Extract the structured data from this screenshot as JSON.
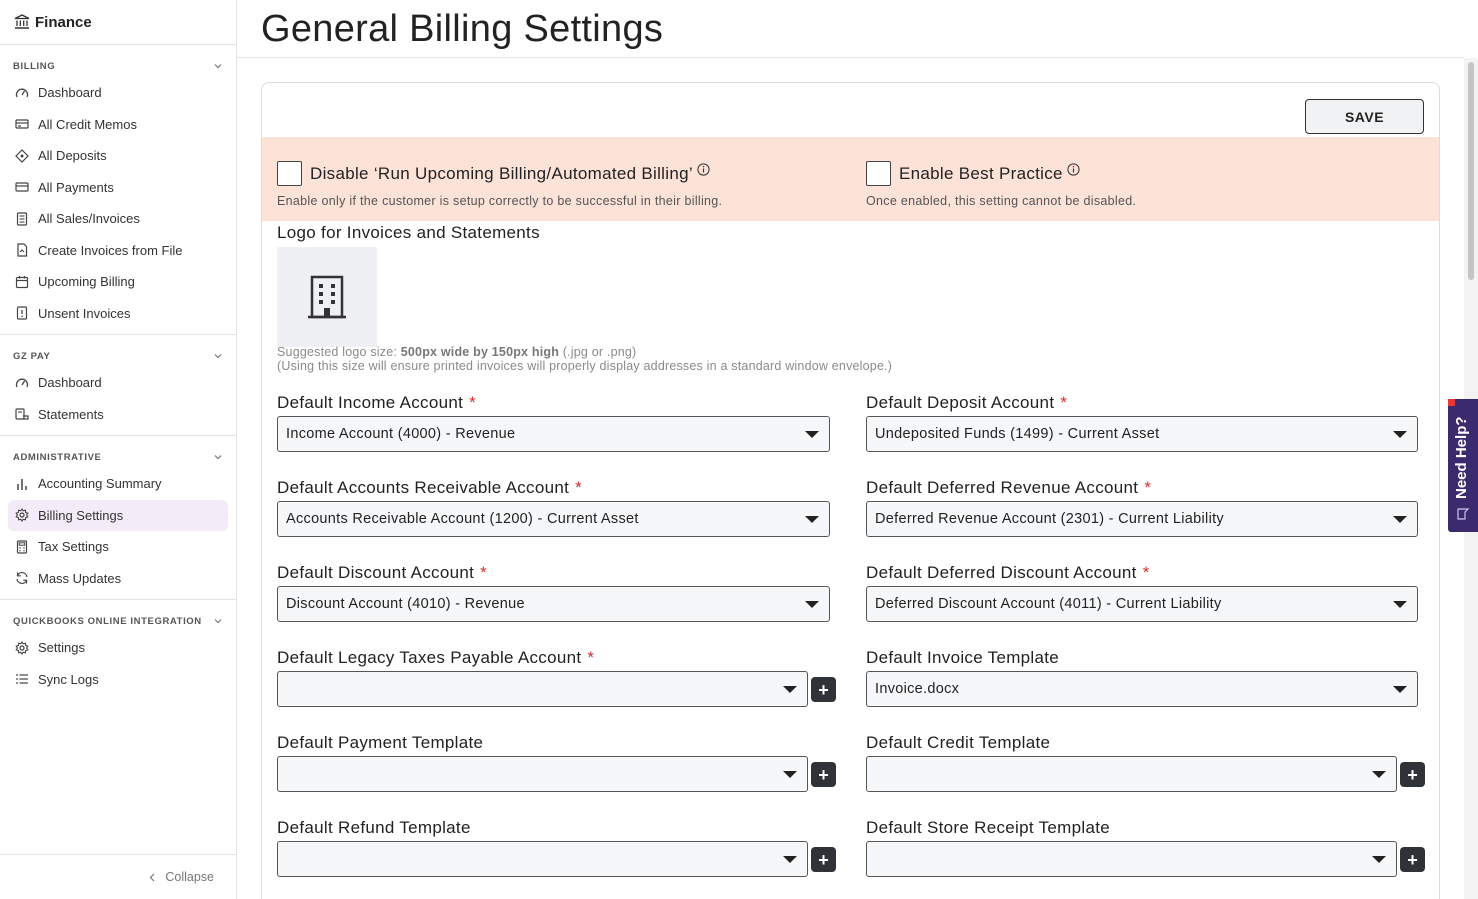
{
  "sidebar": {
    "brand": "Finance",
    "sections": [
      {
        "title": "BILLING",
        "items": [
          {
            "label": "Dashboard",
            "icon": "dashboard-icon"
          },
          {
            "label": "All Credit Memos",
            "icon": "credit-memo-icon"
          },
          {
            "label": "All Deposits",
            "icon": "deposit-icon"
          },
          {
            "label": "All Payments",
            "icon": "payment-icon"
          },
          {
            "label": "All Sales/Invoices",
            "icon": "invoice-icon"
          },
          {
            "label": "Create Invoices from File",
            "icon": "file-icon"
          },
          {
            "label": "Upcoming Billing",
            "icon": "calendar-icon"
          },
          {
            "label": "Unsent Invoices",
            "icon": "unsent-icon"
          }
        ]
      },
      {
        "title": "GZ PAY",
        "items": [
          {
            "label": "Dashboard",
            "icon": "dashboard-icon"
          },
          {
            "label": "Statements",
            "icon": "statements-icon"
          }
        ]
      },
      {
        "title": "ADMINISTRATIVE",
        "items": [
          {
            "label": "Accounting Summary",
            "icon": "chart-icon"
          },
          {
            "label": "Billing Settings",
            "icon": "gear-icon",
            "active": true
          },
          {
            "label": "Tax Settings",
            "icon": "calculator-icon"
          },
          {
            "label": "Mass Updates",
            "icon": "refresh-icon"
          }
        ]
      },
      {
        "title": "QUICKBOOKS ONLINE INTEGRATION",
        "items": [
          {
            "label": "Settings",
            "icon": "gear-icon"
          },
          {
            "label": "Sync Logs",
            "icon": "list-icon"
          }
        ]
      }
    ],
    "collapse_label": "Collapse"
  },
  "page": {
    "title": "General Billing Settings",
    "save_label": "SAVE"
  },
  "warnings": {
    "disable_billing": {
      "label": "Disable ‘Run Upcoming Billing/Automated Billing’",
      "help": "Enable only if the customer is setup correctly to be successful in their billing.",
      "checked": false
    },
    "best_practice": {
      "label": "Enable Best Practice",
      "help": "Once enabled, this setting cannot be disabled.",
      "checked": false
    }
  },
  "logo": {
    "title": "Logo for Invoices and Statements",
    "note_prefix": "Suggested logo size: ",
    "note_size": "500px wide  by 150px high",
    "note_suffix": " (.jpg or .png)",
    "note_line2": "(Using this size will ensure printed invoices will properly display addresses in a standard window envelope.)"
  },
  "fields": {
    "income": {
      "label": "Default Income Account",
      "value": "Income Account (4000) - Revenue",
      "required": "*"
    },
    "deposit": {
      "label": "Default Deposit Account",
      "value": "Undeposited Funds (1499) - Current Asset",
      "required": "*"
    },
    "ar": {
      "label": "Default Accounts Receivable Account",
      "value": "Accounts Receivable Account (1200) - Current Asset",
      "required": "*"
    },
    "deferred_revenue": {
      "label": "Default Deferred Revenue Account",
      "value": "Deferred Revenue Account (2301) - Current Liability",
      "required": "*"
    },
    "discount": {
      "label": "Default Discount Account",
      "value": "Discount Account (4010) - Revenue",
      "required": "*"
    },
    "deferred_discount": {
      "label": "Default Deferred Discount Account",
      "value": "Deferred Discount Account (4011) - Current Liability",
      "required": "*"
    },
    "legacy_taxes": {
      "label": "Default Legacy Taxes Payable Account",
      "value": "",
      "required": "*"
    },
    "invoice_template": {
      "label": "Default Invoice Template",
      "value": "Invoice.docx"
    },
    "payment_template": {
      "label": "Default Payment Template",
      "value": ""
    },
    "credit_template": {
      "label": "Default Credit Template",
      "value": ""
    },
    "refund_template": {
      "label": "Default Refund Template",
      "value": ""
    },
    "store_receipt_template": {
      "label": "Default Store Receipt Template",
      "value": ""
    }
  },
  "help_widget": {
    "label": "Need Help?"
  }
}
